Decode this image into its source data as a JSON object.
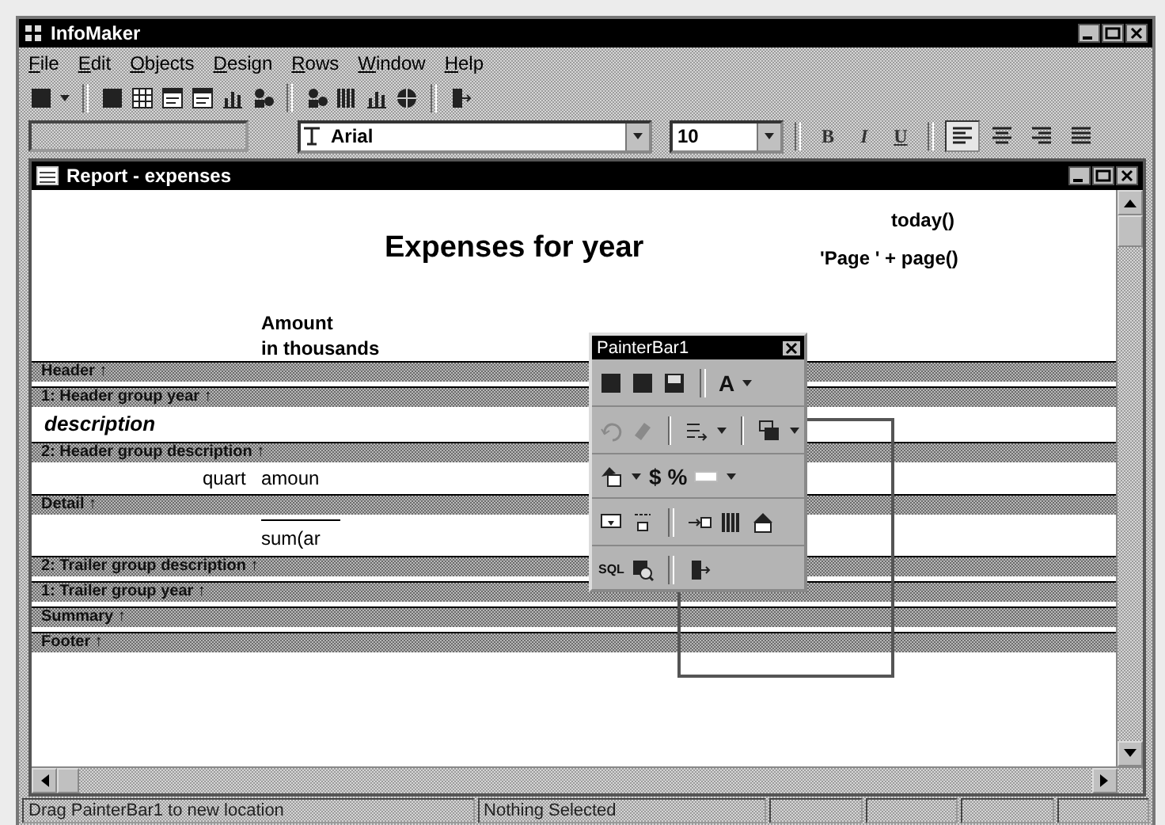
{
  "window": {
    "title": "InfoMaker"
  },
  "menu": [
    "File",
    "Edit",
    "Objects",
    "Design",
    "Rows",
    "Window",
    "Help"
  ],
  "style_bar": {
    "font": "Arial",
    "size": "10",
    "format_buttons": [
      "B",
      "I",
      "U"
    ],
    "alignment_buttons": [
      {
        "selected": true
      },
      {
        "selected": false
      },
      {
        "selected": false
      },
      {
        "selected": false
      }
    ]
  },
  "report_window": {
    "title": "Report - expenses",
    "bands": [
      {
        "label": "Header ↑",
        "objects": [
          {
            "kind": "title",
            "text": "Expenses for year"
          },
          {
            "kind": "computed",
            "text": "today()"
          },
          {
            "kind": "computed",
            "text": "'Page ' + page()"
          },
          {
            "kind": "label",
            "text": "Amount\nin thousands"
          }
        ]
      },
      {
        "label": "1: Header group year ↑"
      },
      {
        "label": "2: Header group description ↑",
        "objects": [
          {
            "kind": "group_column",
            "text": "description"
          }
        ]
      },
      {
        "label": "Detail ↑",
        "objects": [
          {
            "kind": "column",
            "text": "quart"
          },
          {
            "kind": "column",
            "text": "amoun"
          }
        ]
      },
      {
        "label": "2: Trailer group description ↑",
        "objects": [
          {
            "kind": "line"
          },
          {
            "kind": "column",
            "text": "sum(ar"
          }
        ]
      },
      {
        "label": "1: Trailer group year ↑"
      },
      {
        "label": "Summary ↑"
      },
      {
        "label": "Footer ↑"
      }
    ]
  },
  "painter_bar": {
    "title": "PainterBar1",
    "text_buttons": [
      "A",
      "$",
      "%",
      "SQL"
    ]
  },
  "status_bar": [
    "Drag PainterBar1 to new location",
    "Nothing Selected"
  ]
}
